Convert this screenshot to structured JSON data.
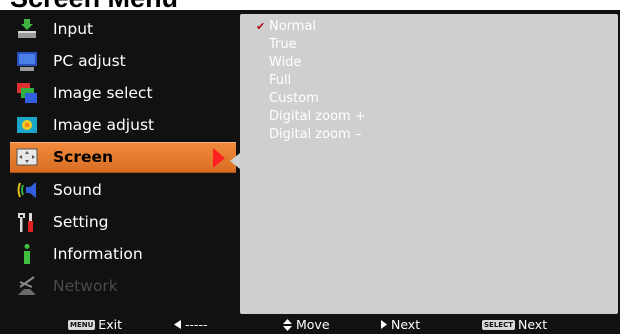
{
  "title": "Screen Menu",
  "menu": [
    {
      "label": "Input",
      "icon": "input-icon",
      "selected": false,
      "disabled": false
    },
    {
      "label": "PC adjust",
      "icon": "pc-monitor-icon",
      "selected": false,
      "disabled": false
    },
    {
      "label": "Image select",
      "icon": "image-select-icon",
      "selected": false,
      "disabled": false
    },
    {
      "label": "Image adjust",
      "icon": "image-adjust-icon",
      "selected": false,
      "disabled": false
    },
    {
      "label": "Screen",
      "icon": "screen-icon",
      "selected": true,
      "disabled": false
    },
    {
      "label": "Sound",
      "icon": "speaker-icon",
      "selected": false,
      "disabled": false
    },
    {
      "label": "Setting",
      "icon": "setting-tools-icon",
      "selected": false,
      "disabled": false
    },
    {
      "label": "Information",
      "icon": "information-icon",
      "selected": false,
      "disabled": false
    },
    {
      "label": "Network",
      "icon": "network-icon",
      "selected": false,
      "disabled": true
    }
  ],
  "options": [
    {
      "label": "Normal",
      "checked": true
    },
    {
      "label": "True",
      "checked": false
    },
    {
      "label": "Wide",
      "checked": false
    },
    {
      "label": "Full",
      "checked": false
    },
    {
      "label": "Custom",
      "checked": false
    },
    {
      "label": "Digital zoom +",
      "checked": false
    },
    {
      "label": "Digital zoom –",
      "checked": false
    }
  ],
  "footer": {
    "menu_key": "MENU",
    "exit": "Exit",
    "back": "-----",
    "move": "Move",
    "next": "Next",
    "select_key": "SELECT",
    "select_next": "Next"
  },
  "colors": {
    "highlight": "#e07a2e",
    "submenu_bg": "#cfcfcf",
    "checkmark": "#b01010",
    "arrow": "#ff2020"
  }
}
